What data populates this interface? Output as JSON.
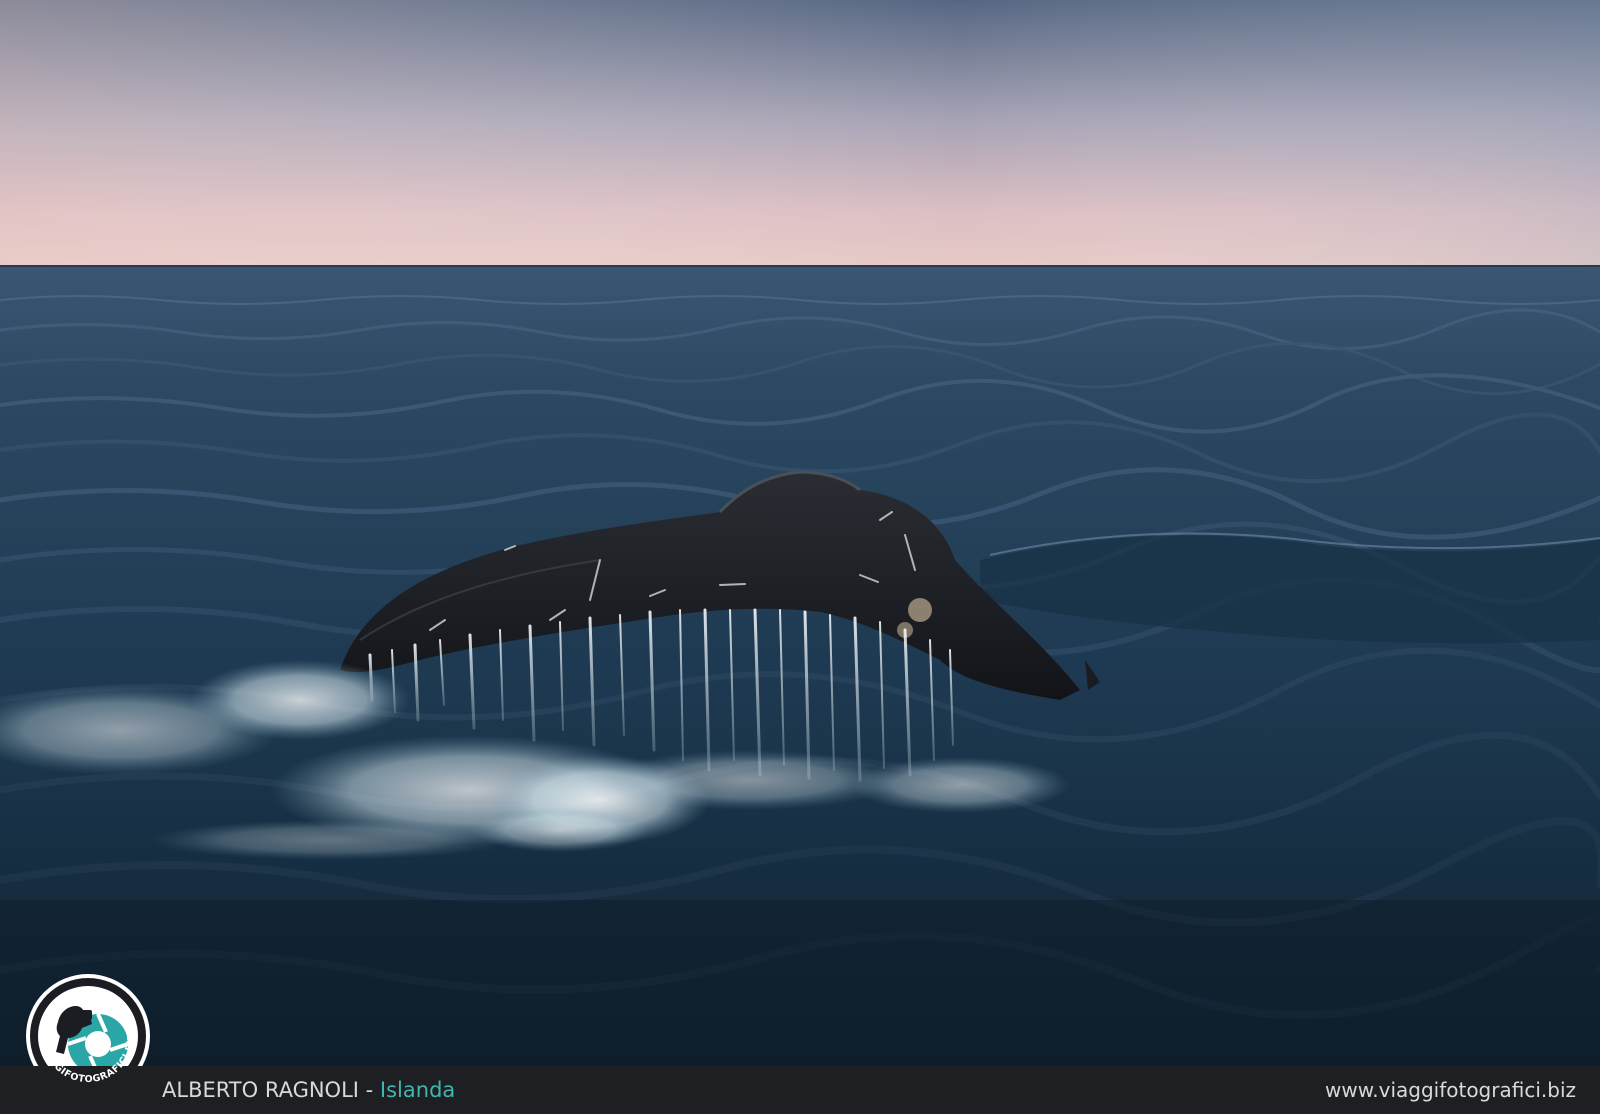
{
  "photo": {
    "subject_icon": "whale-tail-icon",
    "colors": {
      "sky_top": "#5c6a83",
      "sky_horizon": "#e3c3c3",
      "sea_far": "#2b4b66",
      "sea_near": "#14283a",
      "tail": "#1b1d22",
      "splash": "#e9f1f4"
    }
  },
  "logo": {
    "text": "VIAGGIFOTOGRAFICI.BIZ",
    "icon": "photographer-logo-icon",
    "accent_color": "#2aa6a6"
  },
  "caption": {
    "author": "ALBERTO RAGNOLI",
    "separator": " - ",
    "place": "Islanda",
    "website": "www.viaggifotografici.biz",
    "place_color": "#3fb6b0",
    "bar_color": "#1d1f23"
  }
}
